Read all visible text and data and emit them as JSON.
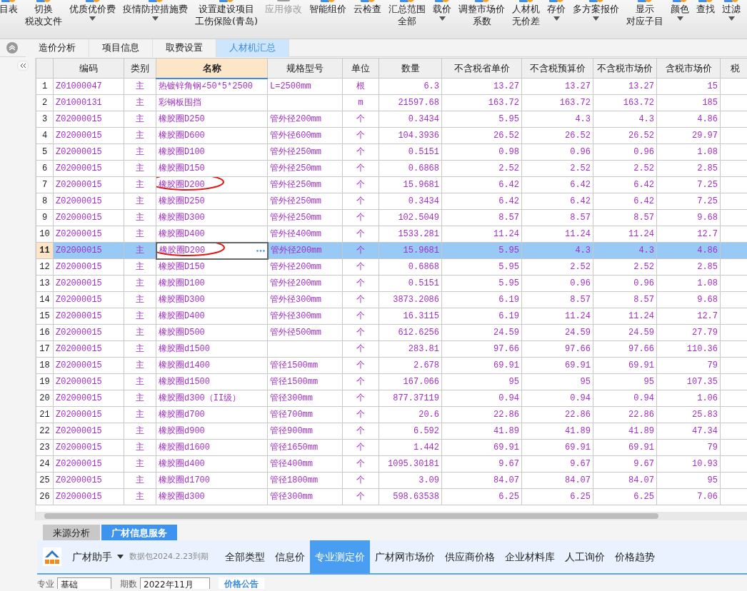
{
  "toolbar": [
    {
      "lines": [
        "目表"
      ],
      "dropdown": false,
      "disabled": false
    },
    {
      "lines": [
        "切换",
        "税改文件"
      ],
      "dropdown": false,
      "disabled": false
    },
    {
      "lines": [
        "优质优价费"
      ],
      "dropdown": true,
      "disabled": false
    },
    {
      "lines": [
        "疫情防控措施费"
      ],
      "dropdown": true,
      "disabled": false
    },
    {
      "lines": [
        "设置建设项目",
        "工伤保险(青岛)"
      ],
      "dropdown": false,
      "disabled": false
    },
    {
      "lines": [
        "应用修改"
      ],
      "dropdown": false,
      "disabled": true
    },
    {
      "lines": [
        "智能组价"
      ],
      "dropdown": false,
      "disabled": false
    },
    {
      "lines": [
        "云检查"
      ],
      "dropdown": false,
      "disabled": false
    },
    {
      "lines": [
        "汇总范围",
        "全部"
      ],
      "dropdown": false,
      "disabled": false
    },
    {
      "lines": [
        "载价"
      ],
      "dropdown": true,
      "disabled": false
    },
    {
      "lines": [
        "调整市场价",
        "系数"
      ],
      "dropdown": false,
      "disabled": false
    },
    {
      "lines": [
        "人材机",
        "无价差"
      ],
      "dropdown": false,
      "disabled": false
    },
    {
      "lines": [
        "存价"
      ],
      "dropdown": true,
      "disabled": false
    },
    {
      "lines": [
        "多方案报价"
      ],
      "dropdown": true,
      "disabled": false
    },
    {
      "lines": [
        "显示",
        "对应子目"
      ],
      "dropdown": false,
      "disabled": false
    },
    {
      "lines": [
        "颜色"
      ],
      "dropdown": true,
      "disabled": false
    },
    {
      "lines": [
        "查找"
      ],
      "dropdown": false,
      "disabled": false
    },
    {
      "lines": [
        "过滤"
      ],
      "dropdown": true,
      "disabled": false
    }
  ],
  "tabs": [
    {
      "label": "造价分析",
      "selected": false
    },
    {
      "label": "项目信息",
      "selected": false
    },
    {
      "label": "取费设置",
      "selected": false
    },
    {
      "label": "人材机汇总",
      "selected": true
    }
  ],
  "grid": {
    "columns": [
      {
        "label": "编码",
        "selected": false
      },
      {
        "label": "类别",
        "selected": false
      },
      {
        "label": "名称",
        "selected": true
      },
      {
        "label": "规格型号",
        "selected": false
      },
      {
        "label": "单位",
        "selected": false
      },
      {
        "label": "数量",
        "selected": false
      },
      {
        "label": "不含税省单价",
        "selected": false
      },
      {
        "label": "不含税预算价",
        "selected": false
      },
      {
        "label": "不含税市场价",
        "selected": false
      },
      {
        "label": "含税市场价",
        "selected": false
      },
      {
        "label": "税",
        "selected": false
      }
    ],
    "rows": [
      {
        "num": "1",
        "code": "Z01000047",
        "type": "主",
        "name": "热镀锌角钢∠50*5*2500",
        "spec": "L=2500mm",
        "unit": "根",
        "qty": "6.3",
        "prices": [
          "13.27",
          "13.27",
          "13.27",
          "15"
        ],
        "selected": false,
        "circled": false
      },
      {
        "num": "2",
        "code": "Z01000131",
        "type": "主",
        "name": "彩钢板围挡",
        "spec": "",
        "unit": "m",
        "qty": "21597.68",
        "prices": [
          "163.72",
          "163.72",
          "163.72",
          "185"
        ],
        "selected": false,
        "circled": false
      },
      {
        "num": "3",
        "code": "Z02000015",
        "type": "主",
        "name": "橡胶圈D250",
        "spec": "管外径200mm",
        "unit": "个",
        "qty": "0.3434",
        "prices": [
          "5.95",
          "4.3",
          "4.3",
          "4.86"
        ],
        "selected": false,
        "circled": false
      },
      {
        "num": "4",
        "code": "Z02000015",
        "type": "主",
        "name": "橡胶圈D600",
        "spec": "管外径600mm",
        "unit": "个",
        "qty": "104.3936",
        "prices": [
          "26.52",
          "26.52",
          "26.52",
          "29.97"
        ],
        "selected": false,
        "circled": false
      },
      {
        "num": "5",
        "code": "Z02000015",
        "type": "主",
        "name": "橡胶圈D100",
        "spec": "管外径250mm",
        "unit": "个",
        "qty": "0.5151",
        "prices": [
          "0.98",
          "0.96",
          "0.96",
          "1.08"
        ],
        "selected": false,
        "circled": false
      },
      {
        "num": "6",
        "code": "Z02000015",
        "type": "主",
        "name": "橡胶圈D150",
        "spec": "管外径250mm",
        "unit": "个",
        "qty": "0.6868",
        "prices": [
          "2.52",
          "2.52",
          "2.52",
          "2.85"
        ],
        "selected": false,
        "circled": false
      },
      {
        "num": "7",
        "code": "Z02000015",
        "type": "主",
        "name": "橡胶圈D200",
        "spec": "管外径250mm",
        "unit": "个",
        "qty": "15.9681",
        "prices": [
          "6.42",
          "6.42",
          "6.42",
          "7.25"
        ],
        "selected": false,
        "circled": true
      },
      {
        "num": "8",
        "code": "Z02000015",
        "type": "主",
        "name": "橡胶圈D250",
        "spec": "管外径250mm",
        "unit": "个",
        "qty": "0.3434",
        "prices": [
          "6.42",
          "6.42",
          "6.42",
          "7.25"
        ],
        "selected": false,
        "circled": false
      },
      {
        "num": "9",
        "code": "Z02000015",
        "type": "主",
        "name": "橡胶圈D300",
        "spec": "管外径250mm",
        "unit": "个",
        "qty": "102.5049",
        "prices": [
          "8.57",
          "8.57",
          "8.57",
          "9.68"
        ],
        "selected": false,
        "circled": false
      },
      {
        "num": "10",
        "code": "Z02000015",
        "type": "主",
        "name": "橡胶圈D400",
        "spec": "管外径400mm",
        "unit": "个",
        "qty": "1533.281",
        "prices": [
          "11.24",
          "11.24",
          "11.24",
          "12.7"
        ],
        "selected": false,
        "circled": false
      },
      {
        "num": "11",
        "code": "Z02000015",
        "type": "主",
        "name": "橡胶圈D200",
        "spec": "管外径200mm",
        "unit": "个",
        "qty": "15.9681",
        "prices": [
          "5.95",
          "4.3",
          "4.3",
          "4.86"
        ],
        "selected": true,
        "circled": true
      },
      {
        "num": "12",
        "code": "Z02000015",
        "type": "主",
        "name": "橡胶圈D150",
        "spec": "管外径200mm",
        "unit": "个",
        "qty": "0.6868",
        "prices": [
          "5.95",
          "2.52",
          "2.52",
          "2.85"
        ],
        "selected": false,
        "circled": false
      },
      {
        "num": "13",
        "code": "Z02000015",
        "type": "主",
        "name": "橡胶圈D100",
        "spec": "管外径200mm",
        "unit": "个",
        "qty": "0.5151",
        "prices": [
          "5.95",
          "0.96",
          "0.96",
          "1.08"
        ],
        "selected": false,
        "circled": false
      },
      {
        "num": "14",
        "code": "Z02000015",
        "type": "主",
        "name": "橡胶圈D300",
        "spec": "管外径300mm",
        "unit": "个",
        "qty": "3873.2086",
        "prices": [
          "6.19",
          "8.57",
          "8.57",
          "9.68"
        ],
        "selected": false,
        "circled": false
      },
      {
        "num": "15",
        "code": "Z02000015",
        "type": "主",
        "name": "橡胶圈D400",
        "spec": "管外径300mm",
        "unit": "个",
        "qty": "16.3115",
        "prices": [
          "6.19",
          "11.24",
          "11.24",
          "12.7"
        ],
        "selected": false,
        "circled": false
      },
      {
        "num": "16",
        "code": "Z02000015",
        "type": "主",
        "name": "橡胶圈D500",
        "spec": "管外径500mm",
        "unit": "个",
        "qty": "612.6256",
        "prices": [
          "24.59",
          "24.59",
          "24.59",
          "27.79"
        ],
        "selected": false,
        "circled": false
      },
      {
        "num": "17",
        "code": "Z02000015",
        "type": "主",
        "name": "橡胶圈d1500",
        "spec": "",
        "unit": "个",
        "qty": "283.81",
        "prices": [
          "97.66",
          "97.66",
          "97.66",
          "110.36"
        ],
        "selected": false,
        "circled": false
      },
      {
        "num": "18",
        "code": "Z02000015",
        "type": "主",
        "name": "橡胶圈d1400",
        "spec": "管径1500mm",
        "unit": "个",
        "qty": "2.678",
        "prices": [
          "69.91",
          "69.91",
          "69.91",
          "79"
        ],
        "selected": false,
        "circled": false
      },
      {
        "num": "19",
        "code": "Z02000015",
        "type": "主",
        "name": "橡胶圈d1500",
        "spec": "管径1500mm",
        "unit": "个",
        "qty": "167.066",
        "prices": [
          "95",
          "95",
          "95",
          "107.35"
        ],
        "selected": false,
        "circled": false
      },
      {
        "num": "20",
        "code": "Z02000015",
        "type": "主",
        "name": "橡胶圈d300（II级）",
        "spec": "管径300mm",
        "unit": "个",
        "qty": "877.37119",
        "prices": [
          "0.94",
          "0.94",
          "0.94",
          "1.06"
        ],
        "selected": false,
        "circled": false
      },
      {
        "num": "21",
        "code": "Z02000015",
        "type": "主",
        "name": "橡胶圈d700",
        "spec": "管径700mm",
        "unit": "个",
        "qty": "20.6",
        "prices": [
          "22.86",
          "22.86",
          "22.86",
          "25.83"
        ],
        "selected": false,
        "circled": false
      },
      {
        "num": "22",
        "code": "Z02000015",
        "type": "主",
        "name": "橡胶圈d900",
        "spec": "管径900mm",
        "unit": "个",
        "qty": "6.592",
        "prices": [
          "41.89",
          "41.89",
          "41.89",
          "47.34"
        ],
        "selected": false,
        "circled": false
      },
      {
        "num": "23",
        "code": "Z02000015",
        "type": "主",
        "name": "橡胶圈d1600",
        "spec": "管径1650mm",
        "unit": "个",
        "qty": "1.442",
        "prices": [
          "69.91",
          "69.91",
          "69.91",
          "79"
        ],
        "selected": false,
        "circled": false
      },
      {
        "num": "24",
        "code": "Z02000015",
        "type": "主",
        "name": "橡胶圈d400",
        "spec": "管径400mm",
        "unit": "个",
        "qty": "1095.30181",
        "prices": [
          "9.67",
          "9.67",
          "9.67",
          "10.93"
        ],
        "selected": false,
        "circled": false
      },
      {
        "num": "25",
        "code": "Z02000015",
        "type": "主",
        "name": "橡胶圈d1700",
        "spec": "管径1800mm",
        "unit": "个",
        "qty": "3.09",
        "prices": [
          "84.07",
          "84.07",
          "84.07",
          "95"
        ],
        "selected": false,
        "circled": false
      },
      {
        "num": "26",
        "code": "Z02000015",
        "type": "主",
        "name": "橡胶圈d300",
        "spec": "管径300mm",
        "unit": "个",
        "qty": "598.63538",
        "prices": [
          "6.25",
          "6.25",
          "6.25",
          "7.06"
        ],
        "selected": false,
        "circled": false
      }
    ]
  },
  "bottom_panel": {
    "tabs": [
      {
        "label": "来源分析",
        "selected": false
      },
      {
        "label": "广材信息服务",
        "selected": true
      }
    ],
    "brand": "广材助手",
    "package_note": "数据包2024.2.23到期",
    "nav": [
      {
        "label": "全部类型",
        "selected": false
      },
      {
        "label": "信息价",
        "selected": false
      },
      {
        "label": "专业测定价",
        "selected": true
      },
      {
        "label": "广材网市场价",
        "selected": false
      },
      {
        "label": "供应商价格",
        "selected": false
      },
      {
        "label": "企业材料库",
        "selected": false
      },
      {
        "label": "人工询价",
        "selected": false
      },
      {
        "label": "价格趋势",
        "selected": false
      }
    ],
    "filters": {
      "specialty_label": "专业",
      "specialty": "基础",
      "period_label": "期数",
      "period": "2022年11月",
      "button": "价格公告"
    }
  }
}
